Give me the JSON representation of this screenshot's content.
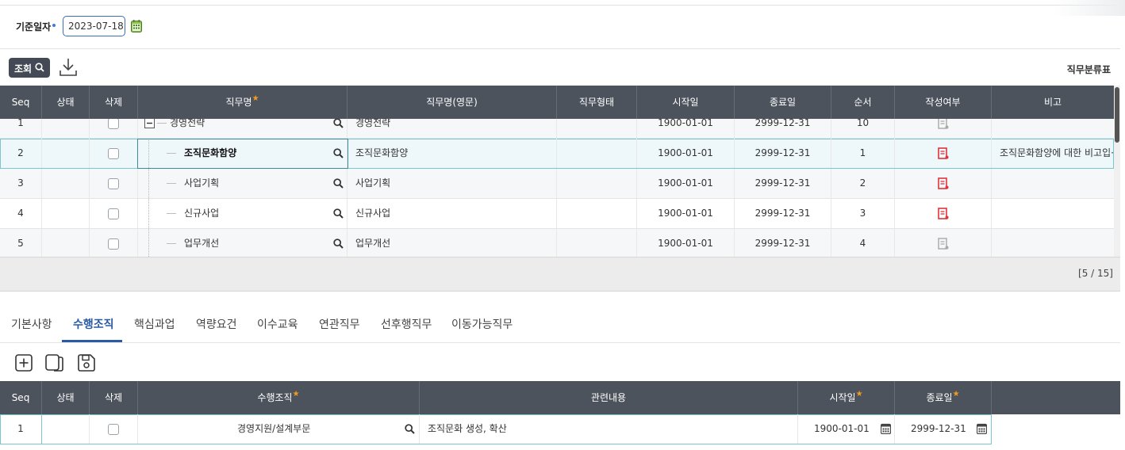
{
  "filter": {
    "label": "기준일자",
    "date_value": "2023-07-18"
  },
  "toolbar": {
    "search_label": "조회",
    "tree_title": "직무분류표"
  },
  "main_grid": {
    "columns": [
      "Seq",
      "상태",
      "삭제",
      "직무명",
      "직무명(영문)",
      "직무형태",
      "시작일",
      "종료일",
      "순서",
      "작성여부",
      "비고"
    ],
    "rows": [
      {
        "seq": "1",
        "name": "경영전략",
        "name_en": "경영전략",
        "start": "1900-01-01",
        "end": "2999-12-31",
        "order": "10",
        "done": false,
        "note": ""
      },
      {
        "seq": "2",
        "name": "조직문화함양",
        "name_en": "조직문화함양",
        "start": "1900-01-01",
        "end": "2999-12-31",
        "order": "1",
        "done": true,
        "note": "조직문화함양에 대한 비고입···"
      },
      {
        "seq": "3",
        "name": "사업기획",
        "name_en": "사업기획",
        "start": "1900-01-01",
        "end": "2999-12-31",
        "order": "2",
        "done": true,
        "note": ""
      },
      {
        "seq": "4",
        "name": "신규사업",
        "name_en": "신규사업",
        "start": "1900-01-01",
        "end": "2999-12-31",
        "order": "3",
        "done": true,
        "note": ""
      },
      {
        "seq": "5",
        "name": "업무개선",
        "name_en": "업무개선",
        "start": "1900-01-01",
        "end": "2999-12-31",
        "order": "4",
        "done": false,
        "note": ""
      }
    ],
    "pager": "[5 / 15]"
  },
  "tabs": [
    "기본사항",
    "수행조직",
    "핵심과업",
    "역량요건",
    "이수교육",
    "연관직무",
    "선후행직무",
    "이동가능직무"
  ],
  "active_tab": "수행조직",
  "sub_grid": {
    "columns": [
      "Seq",
      "상태",
      "삭제",
      "수행조직",
      "관련내용",
      "시작일",
      "종료일"
    ],
    "rows": [
      {
        "seq": "1",
        "org": "경영지원/설계부문",
        "content": "조직문화 생성, 확산",
        "start": "1900-01-01",
        "end": "2999-12-31"
      }
    ]
  },
  "colors": {
    "header_bg": "#4d535c",
    "accent": "#2a5aa3",
    "required_star": "#f39a1e",
    "done_icon": "#e0343a",
    "todo_icon": "#a9a9a9"
  }
}
